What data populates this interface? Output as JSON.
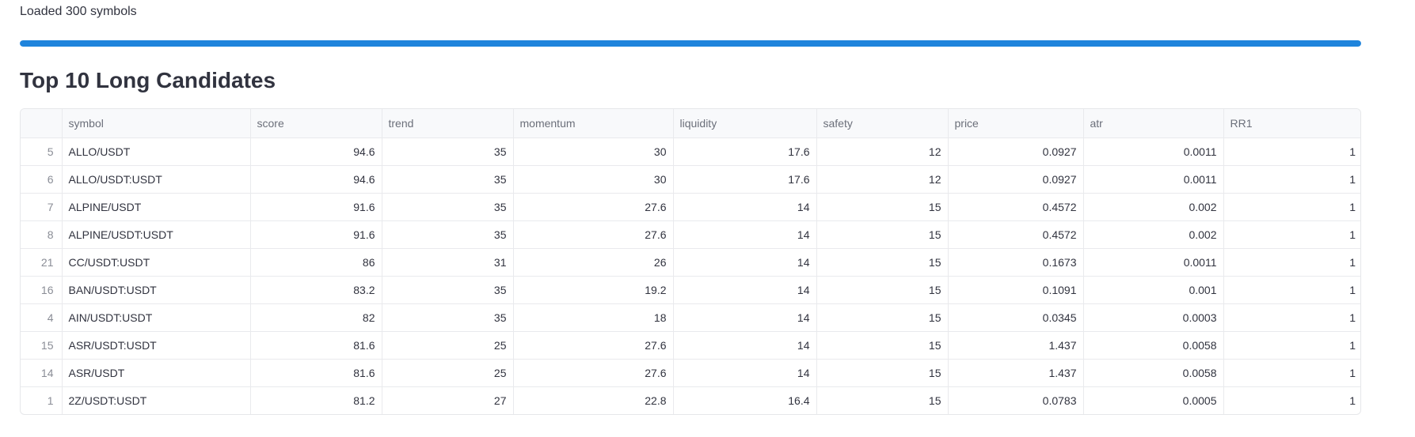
{
  "status": {
    "text": "Loaded 300 symbols",
    "progress_percent": 100,
    "progress_color": "#1f84dc"
  },
  "section": {
    "title": "Top 10 Long Candidates"
  },
  "table": {
    "columns": [
      "",
      "symbol",
      "score",
      "trend",
      "momentum",
      "liquidity",
      "safety",
      "price",
      "atr",
      "RR1"
    ],
    "rows": [
      [
        "5",
        "ALLO/USDT",
        "94.6",
        "35",
        "30",
        "17.6",
        "12",
        "0.0927",
        "0.0011",
        "1"
      ],
      [
        "6",
        "ALLO/USDT:USDT",
        "94.6",
        "35",
        "30",
        "17.6",
        "12",
        "0.0927",
        "0.0011",
        "1"
      ],
      [
        "7",
        "ALPINE/USDT",
        "91.6",
        "35",
        "27.6",
        "14",
        "15",
        "0.4572",
        "0.002",
        "1"
      ],
      [
        "8",
        "ALPINE/USDT:USDT",
        "91.6",
        "35",
        "27.6",
        "14",
        "15",
        "0.4572",
        "0.002",
        "1"
      ],
      [
        "21",
        "CC/USDT:USDT",
        "86",
        "31",
        "26",
        "14",
        "15",
        "0.1673",
        "0.0011",
        "1"
      ],
      [
        "16",
        "BAN/USDT:USDT",
        "83.2",
        "35",
        "19.2",
        "14",
        "15",
        "0.1091",
        "0.001",
        "1"
      ],
      [
        "4",
        "AIN/USDT:USDT",
        "82",
        "35",
        "18",
        "14",
        "15",
        "0.0345",
        "0.0003",
        "1"
      ],
      [
        "15",
        "ASR/USDT:USDT",
        "81.6",
        "25",
        "27.6",
        "14",
        "15",
        "1.437",
        "0.0058",
        "1"
      ],
      [
        "14",
        "ASR/USDT",
        "81.6",
        "25",
        "27.6",
        "14",
        "15",
        "1.437",
        "0.0058",
        "1"
      ],
      [
        "1",
        "2Z/USDT:USDT",
        "81.2",
        "27",
        "22.8",
        "16.4",
        "15",
        "0.0783",
        "0.0005",
        "1"
      ]
    ]
  }
}
